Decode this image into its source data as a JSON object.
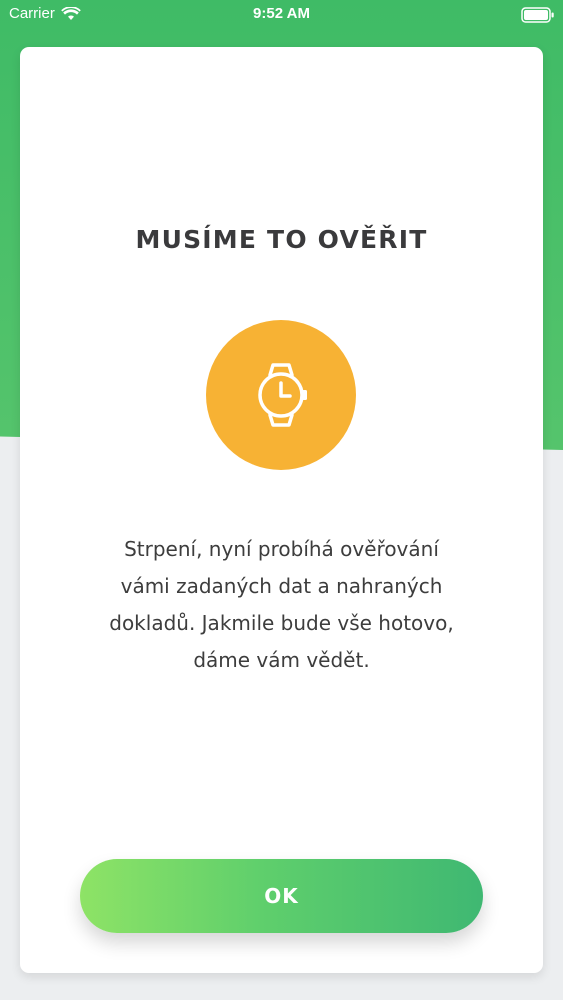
{
  "status_bar": {
    "carrier": "Carrier",
    "time": "9:52 AM"
  },
  "dialog": {
    "title": "MUSÍME TO OVĚŘIT",
    "icon": "watch-icon",
    "message_lines": [
      "Strpení, nyní probíhá ověřování",
      "vámi zadaných dat a nahraných",
      "dokladů. Jakmile bude vše hotovo,",
      "dáme vám vědět."
    ],
    "ok_label": "OK"
  },
  "colors": {
    "accent_green": "#3fbb66",
    "icon_circle": "#f7b234",
    "title_text": "#3a3a3c"
  }
}
